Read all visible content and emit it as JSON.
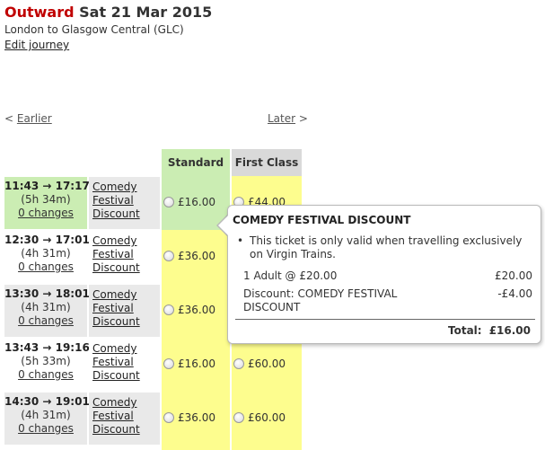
{
  "header": {
    "direction": "Outward",
    "date": "Sat 21 Mar 2015",
    "route": "London to Glasgow Central (GLC)",
    "edit_link": "Edit journey"
  },
  "nav": {
    "earlier": "Earlier",
    "later": "Later",
    "left_chevron": "<",
    "right_chevron": ">"
  },
  "columns": {
    "standard": "Standard",
    "first_class": "First Class"
  },
  "journeys": [
    {
      "times": "11:43 → 17:17",
      "duration": "(5h 34m)",
      "changes": "0 changes",
      "ticket": [
        "Comedy",
        "Festival",
        "Discount"
      ],
      "standard": "£16.00",
      "first": "£44.00"
    },
    {
      "times": "12:30 → 17:01",
      "duration": "(4h 31m)",
      "changes": "0 changes",
      "ticket": [
        "Comedy",
        "Festival",
        "Discount"
      ],
      "standard": "£36.00",
      "first": ""
    },
    {
      "times": "13:30 → 18:01",
      "duration": "(4h 31m)",
      "changes": "0 changes",
      "ticket": [
        "Comedy",
        "Festival",
        "Discount"
      ],
      "standard": "£36.00",
      "first": ""
    },
    {
      "times": "13:43 → 19:16",
      "duration": "(5h 33m)",
      "changes": "0 changes",
      "ticket": [
        "Comedy",
        "Festival",
        "Discount"
      ],
      "standard": "£16.00",
      "first": "£60.00"
    },
    {
      "times": "14:30 → 19:01",
      "duration": "(4h 31m)",
      "changes": "0 changes",
      "ticket": [
        "Comedy",
        "Festival",
        "Discount"
      ],
      "standard": "£36.00",
      "first": "£60.00"
    }
  ],
  "tooltip": {
    "title": "COMEDY FESTIVAL DISCOUNT",
    "note": "This ticket is only valid when travelling exclusively on Virgin Trains.",
    "line1_label": "1 Adult @ £20.00",
    "line1_value": "£20.00",
    "line2_label_a": "Discount: COMEDY FESTIVAL",
    "line2_label_b": "DISCOUNT",
    "line2_value": "-£4.00",
    "total_label": "Total:",
    "total_value": "£16.00"
  },
  "colors": {
    "outward_red": "#c00000",
    "standard_header": "#cbedb3",
    "first_header": "#d9d9d9",
    "fare_yellow": "#fdfd8e",
    "row_grey": "#e9e9e9"
  }
}
